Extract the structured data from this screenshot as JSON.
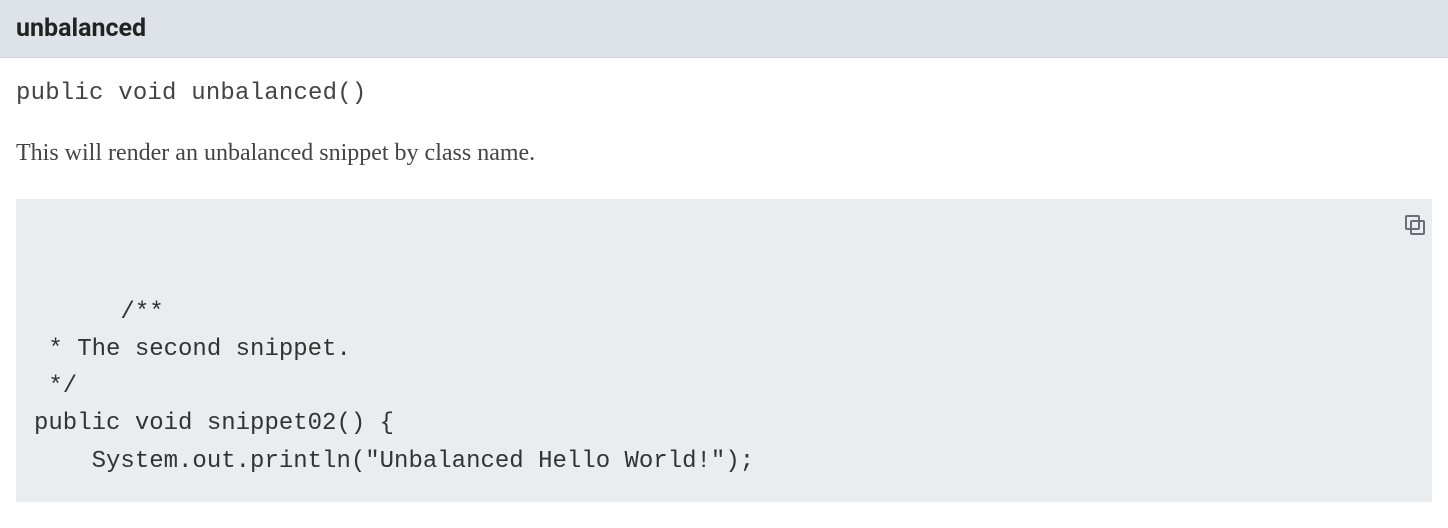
{
  "method": {
    "name": "unbalanced",
    "signature": "public void unbalanced()",
    "description": "This will render an unbalanced snippet by class name.",
    "code": "/**\n * The second snippet.\n */\npublic void snippet02() {\n    System.out.println(\"Unbalanced Hello World!\");"
  }
}
